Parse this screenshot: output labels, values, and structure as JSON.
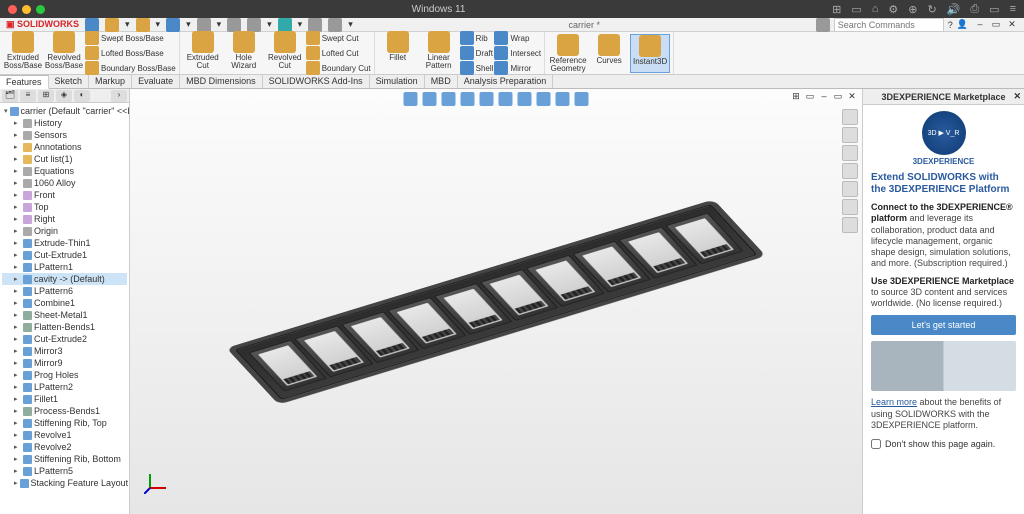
{
  "mac": {
    "title": "Windows 11",
    "icons": [
      "⊞",
      "▭",
      "⌂",
      "⚙",
      "⊕",
      "↻",
      "🔊",
      "⎙",
      "▭",
      "≡"
    ]
  },
  "app": {
    "logo": "SOLIDWORKS",
    "doc_title": "carrier *",
    "search_placeholder": "Search Commands",
    "qat_icons": [
      "home",
      "new",
      "open",
      "save",
      "print",
      "undo",
      "redo",
      "opts",
      "rebuild",
      "gear"
    ]
  },
  "ribbon": {
    "features_big": [
      {
        "label": "Extruded Boss/Base"
      },
      {
        "label": "Revolved Boss/Base"
      }
    ],
    "features_rows": [
      "Swept Boss/Base",
      "Lofted Boss/Base",
      "Boundary Boss/Base"
    ],
    "cut_big": [
      {
        "label": "Extruded Cut"
      },
      {
        "label": "Hole Wizard"
      },
      {
        "label": "Revolved Cut"
      }
    ],
    "cut_rows": [
      "Swept Cut",
      "Lofted Cut",
      "Boundary Cut"
    ],
    "misc_big": [
      {
        "label": "Fillet"
      },
      {
        "label": "Linear Pattern"
      }
    ],
    "misc_rows1": [
      "Rib",
      "Draft",
      "Shell"
    ],
    "misc_rows2": [
      "Wrap",
      "Intersect",
      "Mirror"
    ],
    "right_big": [
      {
        "label": "Reference Geometry"
      },
      {
        "label": "Curves"
      },
      {
        "label": "Instant3D"
      }
    ]
  },
  "tabs": [
    "Features",
    "Sketch",
    "Markup",
    "Evaluate",
    "MBD Dimensions",
    "SOLIDWORKS Add-Ins",
    "Simulation",
    "MBD",
    "Analysis Preparation"
  ],
  "tree": {
    "root": "carrier (Default \"carrier\" <<Default>...",
    "items": [
      {
        "t": "History",
        "k": "doc"
      },
      {
        "t": "Sensors",
        "k": "doc"
      },
      {
        "t": "Annotations",
        "k": "folder"
      },
      {
        "t": "Cut list(1)",
        "k": "folder"
      },
      {
        "t": "Equations",
        "k": "doc"
      },
      {
        "t": "1060 Alloy",
        "k": "doc"
      },
      {
        "t": "Front",
        "k": "plane"
      },
      {
        "t": "Top",
        "k": "plane"
      },
      {
        "t": "Right",
        "k": "plane"
      },
      {
        "t": "Origin",
        "k": "doc"
      },
      {
        "t": "Extrude-Thin1",
        "k": "feat"
      },
      {
        "t": "Cut-Extrude1",
        "k": "feat"
      },
      {
        "t": "LPattern1",
        "k": "feat"
      },
      {
        "t": "cavity -> (Default)",
        "k": "feat",
        "sel": true
      },
      {
        "t": "LPattern6",
        "k": "feat"
      },
      {
        "t": "Combine1",
        "k": "feat"
      },
      {
        "t": "Sheet-Metal1",
        "k": "sheet"
      },
      {
        "t": "Flatten-Bends1",
        "k": "sheet"
      },
      {
        "t": "Cut-Extrude2",
        "k": "feat"
      },
      {
        "t": "Mirror3",
        "k": "feat"
      },
      {
        "t": "Mirror9",
        "k": "feat"
      },
      {
        "t": "Prog Holes",
        "k": "feat"
      },
      {
        "t": "LPattern2",
        "k": "feat"
      },
      {
        "t": "Fillet1",
        "k": "feat"
      },
      {
        "t": "Process-Bends1",
        "k": "sheet"
      },
      {
        "t": "Stiffening Rib, Top",
        "k": "feat"
      },
      {
        "t": "Revolve1",
        "k": "feat"
      },
      {
        "t": "Revolve2",
        "k": "feat"
      },
      {
        "t": "Stiffening Rib, Bottom",
        "k": "feat"
      },
      {
        "t": "LPattern5",
        "k": "feat"
      },
      {
        "t": "Stacking Feature Layout",
        "k": "feat"
      }
    ]
  },
  "market": {
    "header": "3DEXPERIENCE Marketplace",
    "brand": "3DEXPERIENCE",
    "logo_text": "3D ▶ V_R",
    "heading": "Extend SOLIDWORKS with the 3DEXPERIENCE Platform",
    "p1a": "Connect to the 3DEXPERIENCE® platform",
    "p1b": " and leverage its collaboration, product data and lifecycle management, organic shape design, simulation solutions, and more. (Subscription required.)",
    "p2a": "Use 3DEXPERIENCE Marketplace",
    "p2b": " to source 3D content and services worldwide. (No license required.)",
    "btn": "Let's get started",
    "link": "Learn more",
    "p3": " about the benefits of using SOLIDWORKS with the 3DEXPERIENCE platform.",
    "dont_show": "Don't show this page again."
  }
}
